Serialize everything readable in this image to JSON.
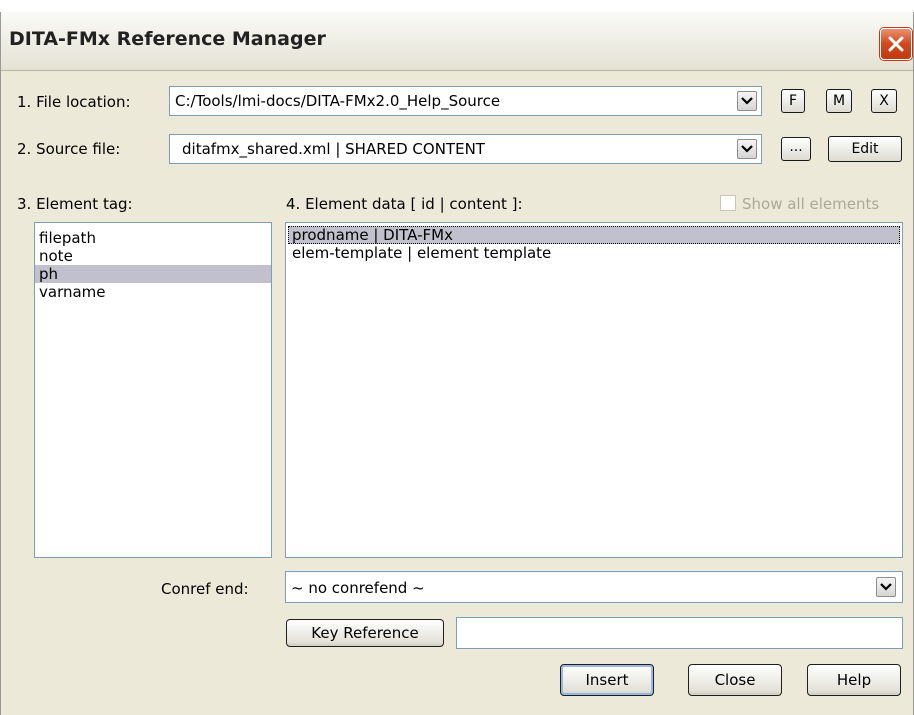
{
  "window": {
    "title": "DITA-FMx Reference Manager"
  },
  "file_location": {
    "label": "1. File location:",
    "value": "C:/Tools/lmi-docs/DITA-FMx2.0_Help_Source",
    "btn_f": "F",
    "btn_m": "M",
    "btn_x": "X"
  },
  "source_file": {
    "label": "2. Source file:",
    "value": "ditafmx_shared.xml | SHARED CONTENT",
    "browse_label": "...",
    "edit_label": "Edit"
  },
  "element_tag": {
    "label": "3. Element tag:",
    "items": [
      "filepath",
      "note",
      "ph",
      "varname"
    ],
    "selected": "ph"
  },
  "element_data": {
    "label": "4. Element data [ id | content ]:",
    "show_all_label": "Show all elements",
    "show_all_checked": false,
    "items": [
      "prodname | DITA-FMx",
      "elem-template | element template"
    ],
    "selected": "prodname | DITA-FMx"
  },
  "conref_end": {
    "label": "Conref end:",
    "value": "~ no conrefend ~"
  },
  "key_reference": {
    "button_label": "Key Reference",
    "value": ""
  },
  "buttons": {
    "insert": "Insert",
    "close": "Close",
    "help": "Help"
  }
}
